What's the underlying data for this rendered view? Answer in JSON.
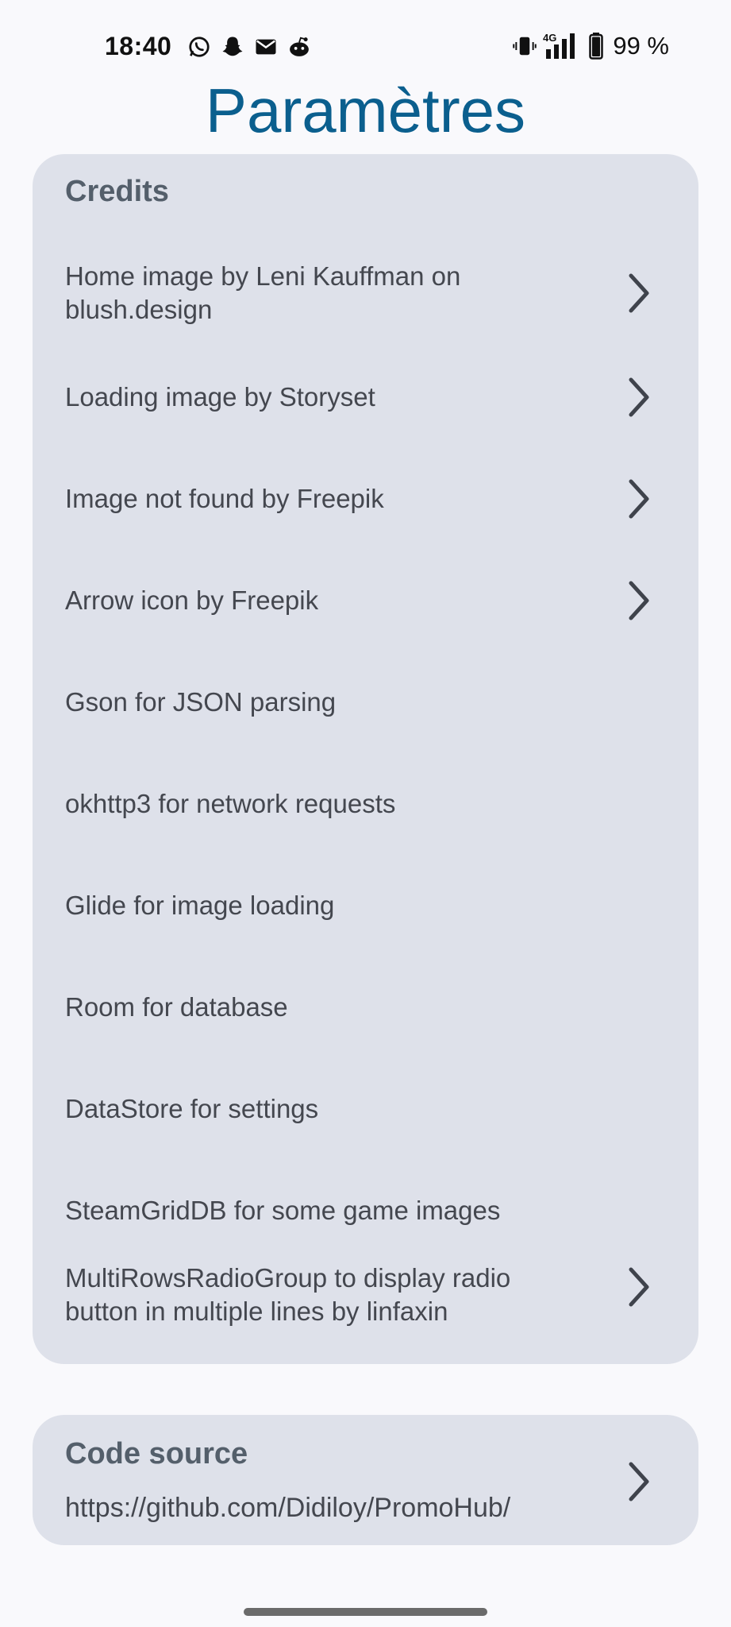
{
  "status_bar": {
    "time": "18:40",
    "battery": "99 %",
    "network": "4G",
    "notification_icons": [
      "whatsapp-icon",
      "snapchat-icon",
      "mail-icon",
      "reddit-icon"
    ]
  },
  "page": {
    "title": "Paramètres"
  },
  "credits": {
    "header": "Credits",
    "items": [
      {
        "label": "Home image by Leni Kauffman on blush.design",
        "has_link": true
      },
      {
        "label": "Loading image by Storyset",
        "has_link": true
      },
      {
        "label": "Image not found by Freepik",
        "has_link": true
      },
      {
        "label": "Arrow icon by Freepik",
        "has_link": true
      },
      {
        "label": "Gson for JSON parsing",
        "has_link": false
      },
      {
        "label": "okhttp3 for network requests",
        "has_link": false
      },
      {
        "label": "Glide for image loading",
        "has_link": false
      },
      {
        "label": "Room for database",
        "has_link": false
      },
      {
        "label": "DataStore for settings",
        "has_link": false
      },
      {
        "label": "SteamGridDB for some game images",
        "has_link": false
      },
      {
        "label": "MultiRowsRadioGroup to display radio button in multiple lines by linfaxin",
        "has_link": true
      }
    ]
  },
  "code_source": {
    "header": "Code source",
    "url": "https://github.com/Didiloy/PromoHub/"
  },
  "colors": {
    "title": "#0b5f8e",
    "card_bg": "#dee1ea",
    "header_text": "#545f6b",
    "body_text": "#44474f",
    "background": "#f9f9fc"
  }
}
